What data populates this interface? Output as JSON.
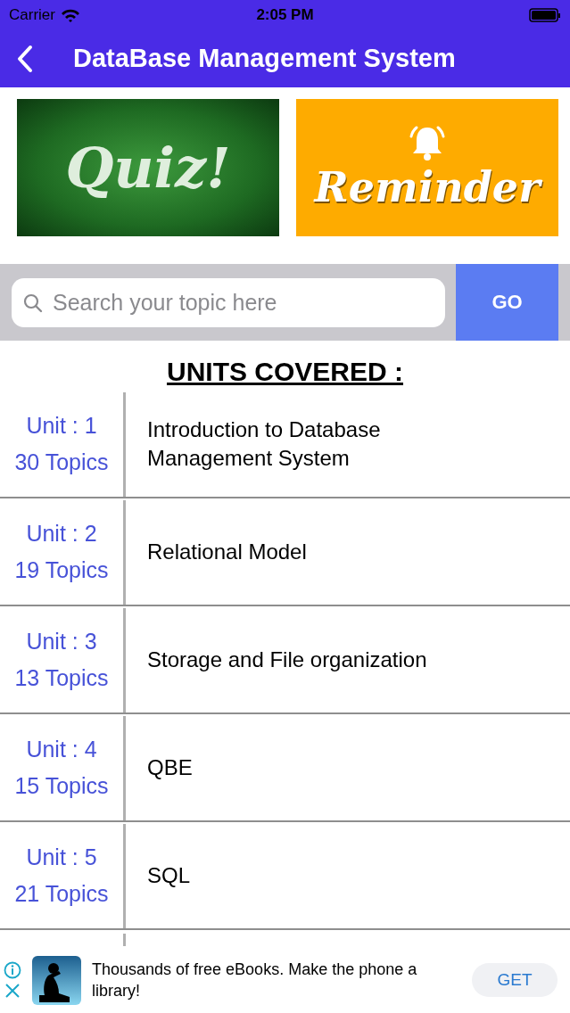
{
  "status_bar": {
    "carrier": "Carrier",
    "time": "2:05 PM"
  },
  "nav": {
    "title": "DataBase Management System"
  },
  "banners": [
    {
      "kind": "photo",
      "label": "Quiz!"
    },
    {
      "kind": "reminder",
      "label": "Reminder"
    }
  ],
  "search": {
    "placeholder": "Search your topic here",
    "button": "GO"
  },
  "heading": "UNITS COVERED :",
  "units": [
    {
      "unit": "Unit : 1",
      "topics": "30 Topics",
      "title": "Introduction to Database Management System"
    },
    {
      "unit": "Unit : 2",
      "topics": "19 Topics",
      "title": "Relational Model"
    },
    {
      "unit": "Unit : 3",
      "topics": "13 Topics",
      "title": "Storage and File organization"
    },
    {
      "unit": "Unit : 4",
      "topics": "15 Topics",
      "title": "QBE"
    },
    {
      "unit": "Unit : 5",
      "topics": "21 Topics",
      "title": "SQL"
    }
  ],
  "ad": {
    "text": "Thousands of free eBooks. Make the phone a library!",
    "button": "GET"
  }
}
